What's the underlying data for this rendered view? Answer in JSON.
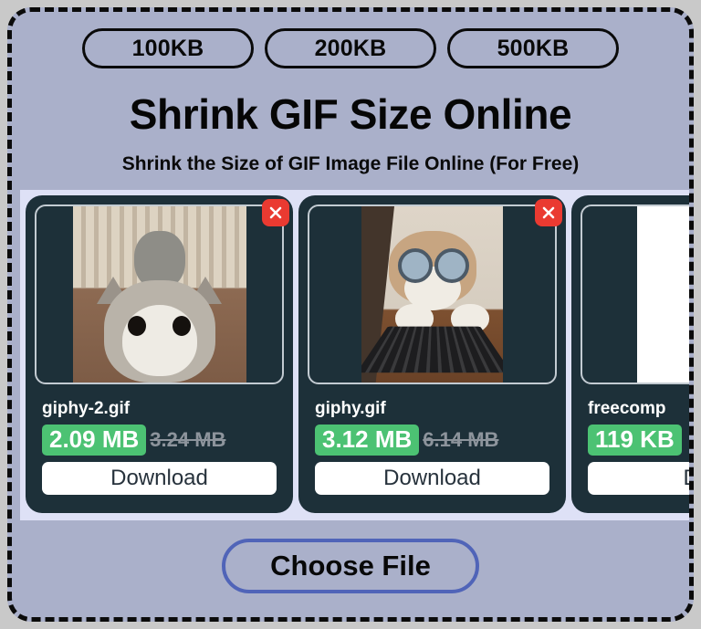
{
  "presets": [
    {
      "label": "100KB",
      "name": "preset-100kb"
    },
    {
      "label": "200KB",
      "name": "preset-200kb"
    },
    {
      "label": "500KB",
      "name": "preset-500kb"
    }
  ],
  "header": {
    "title": "Shrink GIF Size Online",
    "subtitle": "Shrink the Size of GIF Image File Online (For Free)"
  },
  "colors": {
    "page_background": "#c9c9c9",
    "dropzone_background": "#aab0ca",
    "dropzone_border": "#0b0b0b",
    "carousel_background": "#dee1f6",
    "card_background": "#1d3039",
    "badge_green": "#4cc273",
    "close_red": "#ea3a31",
    "choose_file_border": "#5064b8",
    "old_size_text": "#8d949c"
  },
  "carousel": {
    "cards": [
      {
        "file_name": "giphy-2.gif",
        "new_size": "2.09 MB",
        "old_size": "3.24 MB",
        "download_label": "Download",
        "close_label": "×",
        "thumbnail": "two-cats-gif-thumbnail"
      },
      {
        "file_name": "giphy.gif",
        "new_size": "3.12 MB",
        "old_size": "6.14 MB",
        "download_label": "Download",
        "close_label": "×",
        "thumbnail": "cat-with-glasses-laptop-gif-thumbnail"
      },
      {
        "file_name": "freecomp",
        "new_size": "119 KB",
        "old_size": "",
        "download_label": "Dow",
        "close_label": "×",
        "thumbnail": "green-rounded-shape-gif-thumbnail"
      }
    ]
  },
  "footer": {
    "choose_file_label": "Choose File"
  }
}
